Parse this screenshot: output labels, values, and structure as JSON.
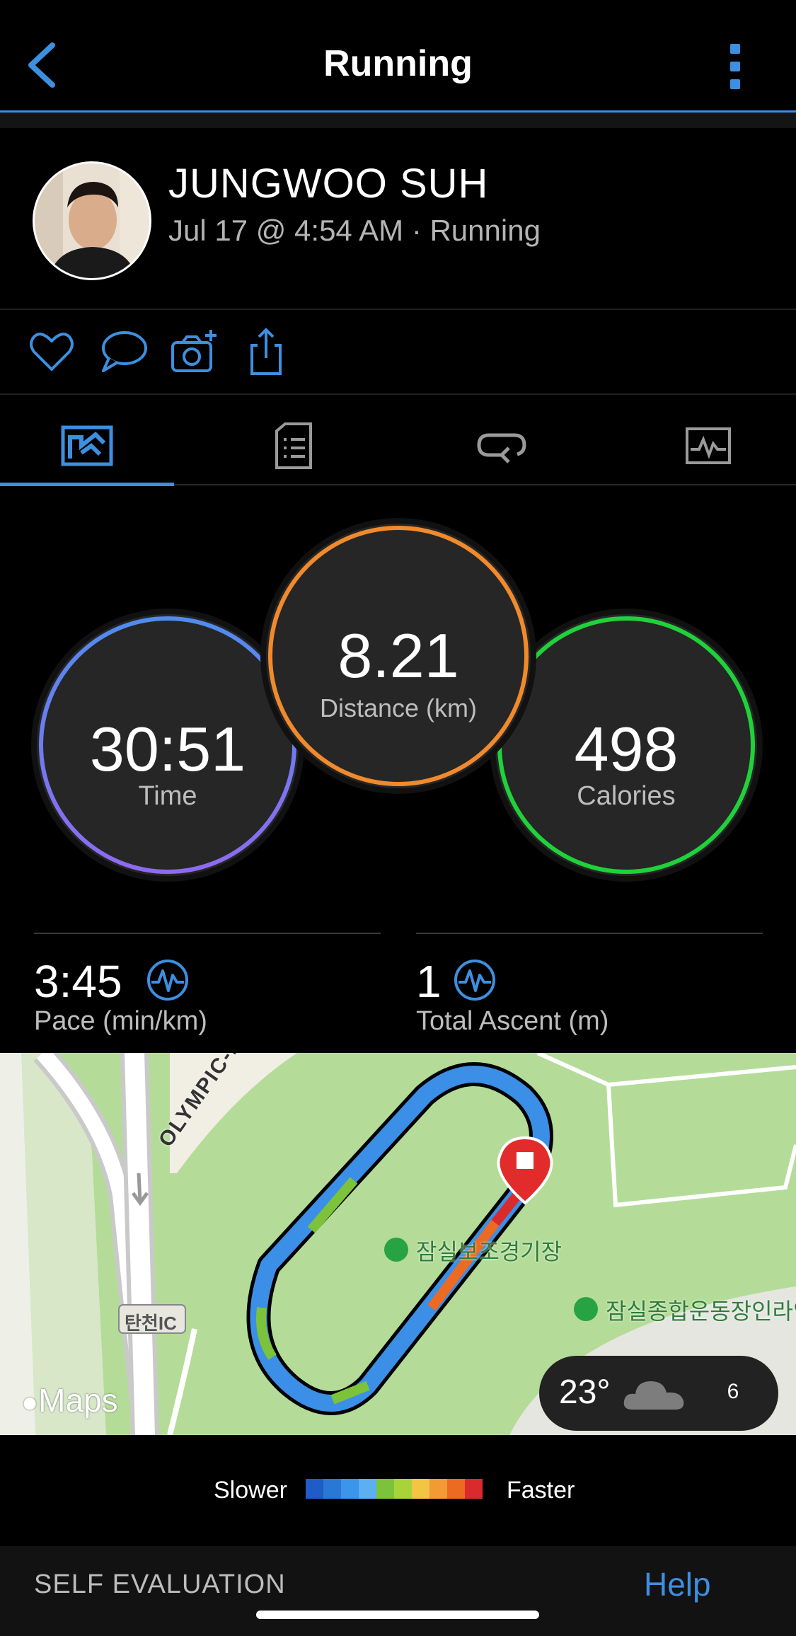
{
  "header": {
    "title": "Running"
  },
  "profile": {
    "name": "JUNGWOO SUH",
    "subtitle": "Jul 17 @ 4:54 AM · Running"
  },
  "actions": [
    "heart-icon",
    "comment-icon",
    "add-photo-icon",
    "share-icon"
  ],
  "tabs": [
    "map-tab-icon",
    "details-tab-icon",
    "laps-tab-icon",
    "charts-tab-icon"
  ],
  "metrics": {
    "time": {
      "value": "30:51",
      "label": "Time"
    },
    "distance": {
      "value": "8.21",
      "label": "Distance (km)"
    },
    "calories": {
      "value": "498",
      "label": "Calories"
    }
  },
  "stats": {
    "pace": {
      "value": "3:45",
      "label": "Pace (min/km)"
    },
    "ascent": {
      "value": "1",
      "label": "Total Ascent (m)"
    }
  },
  "map": {
    "road_label": "OLYMPIC-DAERO",
    "place1": "잠실보조경기장",
    "place2": "잠실종합운동장인라인",
    "ic_label": "탄천IC",
    "logo": "Maps",
    "weather": {
      "temp": "23°",
      "wind": "6"
    }
  },
  "legend": {
    "slower": "Slower",
    "faster": "Faster",
    "colors": [
      "#1f5cc7",
      "#2a78d6",
      "#3b95ea",
      "#5ab0f0",
      "#7cc23b",
      "#a8d43a",
      "#f4c542",
      "#f29a33",
      "#ec6a22",
      "#d92b2b"
    ]
  },
  "footer": {
    "self_evaluation": "SELF EVALUATION",
    "help": "Help"
  },
  "colors": {
    "accent": "#3d8fe0",
    "time_ring": "#6d8df0",
    "distance_ring": "#f08a2c",
    "calories_ring": "#1fd23a"
  }
}
